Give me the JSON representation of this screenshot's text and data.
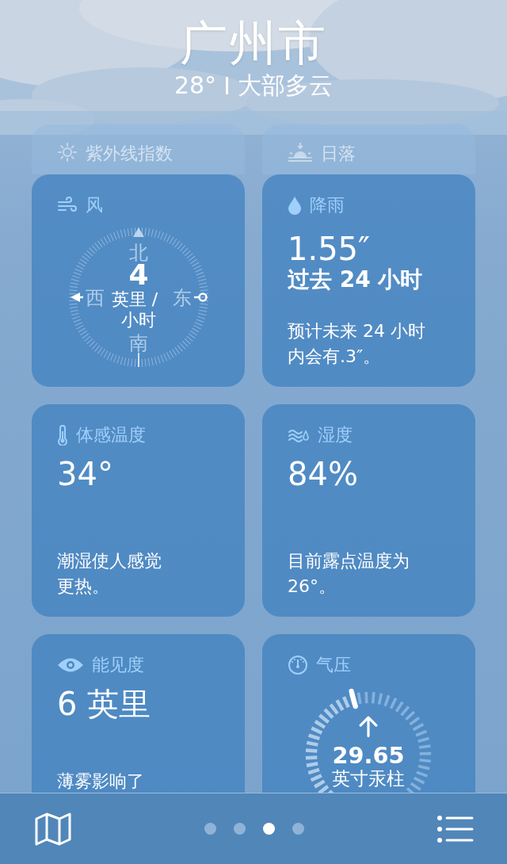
{
  "location": {
    "city": "广州市",
    "temperature": "28°",
    "condition": "大部多云"
  },
  "collapsed_cards": [
    {
      "kind": "uv",
      "title": "紫外线指数"
    },
    {
      "kind": "sunset",
      "title": "日落"
    }
  ],
  "cards": [
    {
      "kind": "wind",
      "title": "风",
      "value": "4",
      "unit": "英里 / 小时",
      "north": "北",
      "east": "东",
      "south": "南",
      "west": "西"
    },
    {
      "kind": "rain",
      "title": "降雨",
      "value": "1.55″",
      "period": "过去 24 小时",
      "note": "预计未来 24 小时内会有.3″。"
    },
    {
      "kind": "feels",
      "title": "体感温度",
      "value": "34°",
      "note": "潮湿使人感觉更热。"
    },
    {
      "kind": "humidity",
      "title": "湿度",
      "value": "84%",
      "note": "目前露点温度为26°。"
    },
    {
      "kind": "visibility",
      "title": "能见度",
      "value": "6 英里",
      "note": "薄雾影响了"
    },
    {
      "kind": "pressure",
      "title": "气压",
      "value": "29.65",
      "unit": "英寸汞柱"
    }
  ],
  "tab_bar": {
    "pages": [
      {
        "selected": false
      },
      {
        "selected": false
      },
      {
        "selected": true
      },
      {
        "selected": false
      }
    ]
  }
}
